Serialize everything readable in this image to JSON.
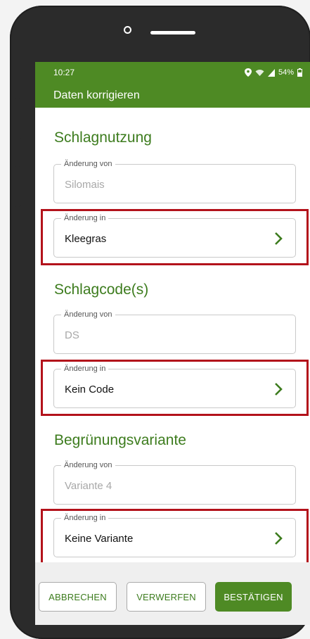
{
  "status_bar": {
    "time": "10:27",
    "battery": "54%"
  },
  "app_bar": {
    "title": "Daten korrigieren"
  },
  "sections": [
    {
      "title": "Schlagnutzung",
      "from": {
        "label": "Änderung von",
        "value": "Silomais"
      },
      "to": {
        "label": "Änderung in",
        "value": "Kleegras"
      }
    },
    {
      "title": "Schlagcode(s)",
      "from": {
        "label": "Änderung von",
        "value": "DS"
      },
      "to": {
        "label": "Änderung in",
        "value": "Kein Code"
      }
    },
    {
      "title": "Begrünungsvariante",
      "from": {
        "label": "Änderung von",
        "value": "Variante 4"
      },
      "to": {
        "label": "Änderung in",
        "value": "Keine Variante"
      }
    }
  ],
  "actions": {
    "cancel": "ABBRECHEN",
    "discard": "VERWERFEN",
    "confirm": "BESTÄTIGEN"
  },
  "colors": {
    "primary": "#4e8a24",
    "highlight": "#b3121b"
  },
  "icons": {
    "chevron": "chevron-right-icon",
    "location": "location-icon",
    "wifi": "wifi-icon",
    "signal": "signal-icon",
    "battery": "battery-icon"
  }
}
